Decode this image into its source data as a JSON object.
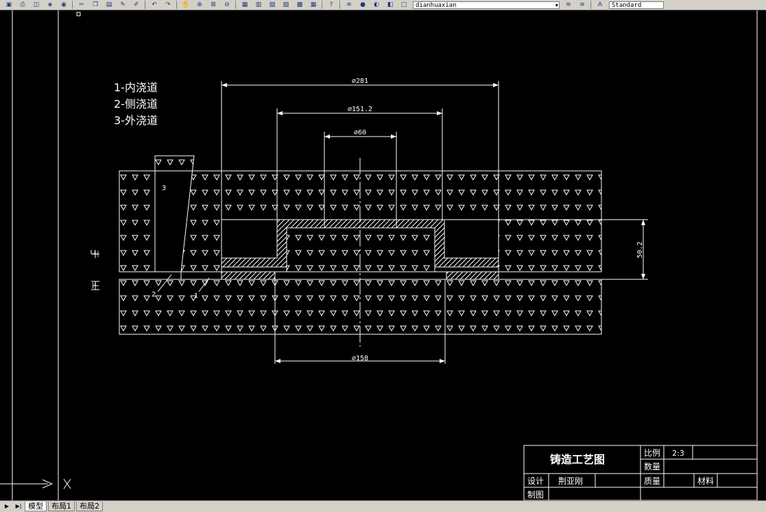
{
  "toolbar": {
    "icons": [
      "save-icon",
      "print-icon",
      "preview-icon",
      "publish-icon",
      "plot-icon",
      "cut-icon",
      "copy-icon",
      "paste-icon",
      "match-properties-icon",
      "brush-icon",
      "undo-icon",
      "redo-icon",
      "pan-icon",
      "zoom-realtime-icon",
      "zoom-window-icon",
      "zoom-previous-icon",
      "properties-icon",
      "design-center-icon",
      "tool-palette-icon",
      "sheet-set-icon",
      "markup-icon",
      "calculator-icon",
      "help-icon",
      "layer-manager-icon",
      "layer-on-icon",
      "layer-freeze-icon",
      "layer-lock-icon",
      "layer-color-icon"
    ],
    "layer_value": "dianhuaxian",
    "style_value": "Standard"
  },
  "notes": {
    "line1": "1-内浇道",
    "line2": "2-侧浇道",
    "line3": "3-外浇道"
  },
  "dimensions": {
    "d281": "⌀281",
    "d151": "⌀151.2",
    "d60": "⌀60",
    "d158": "⌀158",
    "h50": "50.2"
  },
  "marks": {
    "up": "上",
    "down": "下",
    "gate3": "3",
    "gate2": "2",
    "gate1": "1"
  },
  "title_block": {
    "title": "铸造工艺图",
    "scale_label": "比例",
    "scale_value": "2:3",
    "qty_label": "数量",
    "design_label": "设计",
    "designer": "荆亚刚",
    "mass_label": "质量",
    "material_label": "材料",
    "draw_label": "制图"
  },
  "tabs": {
    "model": "模型",
    "layout1": "布局1",
    "layout2": "布局2"
  },
  "colors": {
    "background": "#000000",
    "lines": "#ffffff",
    "chrome": "#d4d0c8"
  }
}
